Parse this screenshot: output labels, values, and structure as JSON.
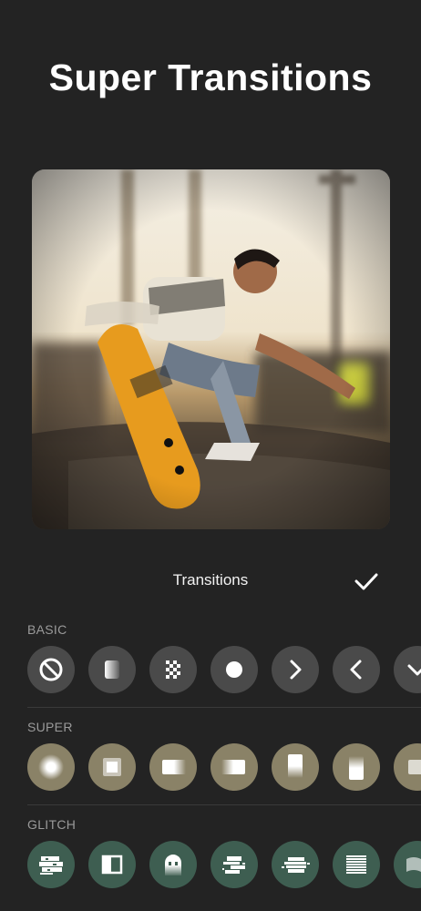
{
  "headline": "Super Transitions",
  "panel": {
    "title": "Transitions",
    "confirm_icon": "checkmark-icon"
  },
  "sections": [
    {
      "label": "BASIC",
      "color": "#4a4a4a",
      "icons": [
        "none-icon",
        "gradient-fade-icon",
        "dissolve-icon",
        "circle-icon",
        "chevron-right-icon",
        "chevron-left-icon",
        "chevron-down-icon"
      ]
    },
    {
      "label": "SUPER",
      "color": "#8a8267",
      "icons": [
        "zoom-glow-icon",
        "zoom-frame-icon",
        "slide-right-blur-icon",
        "slide-left-blur-icon",
        "slide-up-blur-icon",
        "slide-down-blur-icon",
        "slide-partial-icon"
      ]
    },
    {
      "label": "GLITCH",
      "color": "#3e5e51",
      "icons": [
        "glitch-block-icon",
        "split-panel-icon",
        "ghost-icon",
        "glitch-shift-icon",
        "glitch-scan-icon",
        "scanline-icon",
        "glitch-wave-icon"
      ]
    }
  ]
}
